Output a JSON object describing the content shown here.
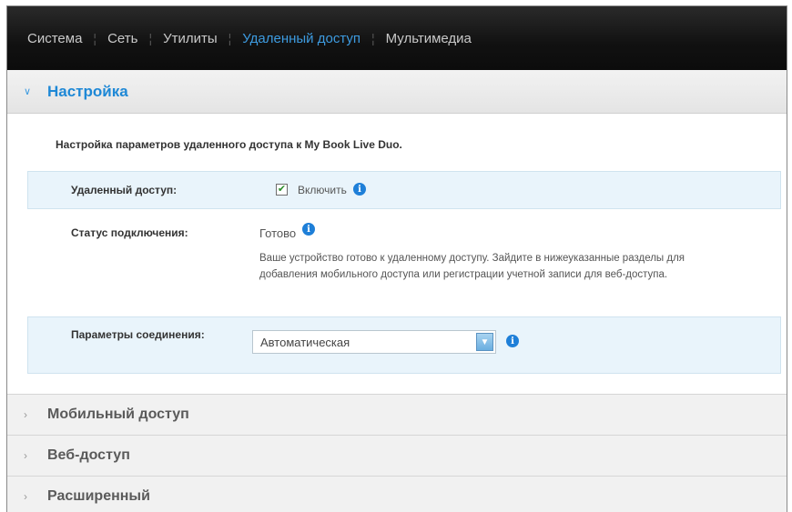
{
  "nav": {
    "items": [
      {
        "label": "Система"
      },
      {
        "label": "Сеть"
      },
      {
        "label": "Утилиты"
      },
      {
        "label": "Удаленный доступ"
      },
      {
        "label": "Мультимедиа"
      }
    ],
    "active_index": 3
  },
  "section": {
    "title": "Настройка",
    "expanded": true,
    "intro": "Настройка параметров удаленного доступа к My Book Live Duo.",
    "remote_access": {
      "label": "Удаленный доступ:",
      "checkbox_label": "Включить",
      "checked": true
    },
    "status": {
      "label": "Статус подключения:",
      "value": "Готово",
      "description": "Ваше устройство готово к удаленному доступу. Зайдите в нижеуказанные разделы для добавления мобильного доступа или регистрации учетной записи для веб-доступа."
    },
    "connection": {
      "label": "Параметры соединения:",
      "selected": "Автоматическая"
    }
  },
  "collapsed_sections": [
    {
      "title": "Мобильный доступ"
    },
    {
      "title": "Веб-доступ"
    },
    {
      "title": "Расширенный"
    }
  ],
  "colors": {
    "accent": "#1e88d6",
    "highlight_row": "#e9f4fb",
    "nav_bg": "#111111"
  }
}
